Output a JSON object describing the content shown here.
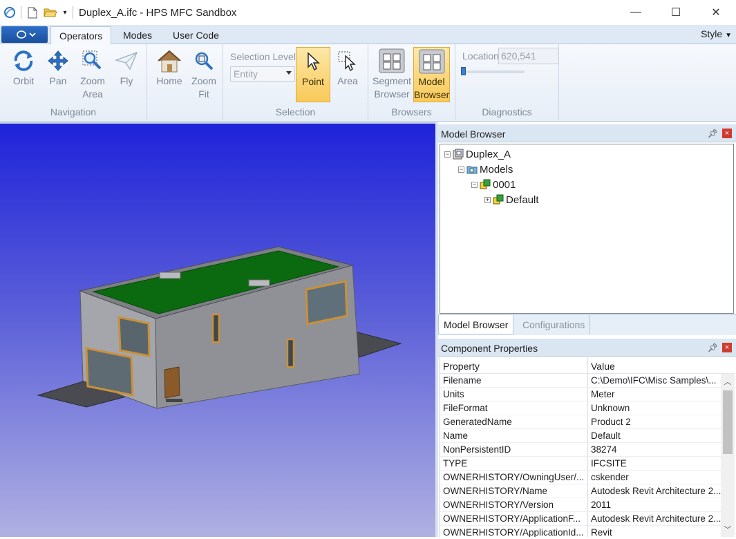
{
  "window": {
    "title": "Duplex_A.ifc - HPS MFC Sandbox",
    "minimize": "—",
    "maximize": "☐",
    "close": "✕"
  },
  "ribbon": {
    "tabs": [
      {
        "label": "Operators",
        "active": true
      },
      {
        "label": "Modes",
        "active": false
      },
      {
        "label": "User Code",
        "active": false
      }
    ],
    "style_label": "Style",
    "groups": {
      "navigation": {
        "label": "Navigation",
        "buttons": [
          {
            "label": "Orbit",
            "icon": "orbit-icon"
          },
          {
            "label": "Pan",
            "icon": "pan-icon"
          },
          {
            "label": "Zoom Area",
            "icon": "zoom-area-icon"
          },
          {
            "label": "Fly",
            "icon": "fly-icon"
          }
        ]
      },
      "home": {
        "buttons": [
          {
            "label": "Home",
            "icon": "home-icon"
          },
          {
            "label": "Zoom Fit",
            "icon": "zoom-fit-icon"
          }
        ]
      },
      "selection": {
        "label": "Selection",
        "level_label": "Selection Level",
        "level_value": "Entity",
        "buttons": [
          {
            "label": "Point",
            "icon": "point-cursor-icon",
            "active": true
          },
          {
            "label": "Area",
            "icon": "area-select-icon",
            "active": false
          }
        ]
      },
      "browsers": {
        "label": "Browsers",
        "buttons": [
          {
            "label": "Segment Browser",
            "icon": "segment-browser-icon",
            "active": false
          },
          {
            "label": "Model Browser",
            "icon": "model-browser-icon",
            "active": true
          }
        ]
      },
      "diagnostics": {
        "label": "Diagnostics",
        "location_label": "Location",
        "location_value": "620,541"
      }
    }
  },
  "model_browser": {
    "title": "Model Browser",
    "tree": [
      {
        "label": "Duplex_A",
        "expander": "−"
      },
      {
        "label": "Models",
        "expander": "−"
      },
      {
        "label": "0001",
        "expander": "−"
      },
      {
        "label": "Default",
        "expander": "+"
      }
    ],
    "tabs": [
      {
        "label": "Model Browser",
        "active": true
      },
      {
        "label": "Configurations",
        "active": false
      }
    ]
  },
  "component_properties": {
    "title": "Component Properties",
    "columns": [
      "Property",
      "Value"
    ],
    "rows": [
      [
        "Filename",
        "C:\\Demo\\IFC\\Misc Samples\\..."
      ],
      [
        "Units",
        "Meter"
      ],
      [
        "FileFormat",
        "Unknown"
      ],
      [
        "GeneratedName",
        "Product 2"
      ],
      [
        "Name",
        "Default"
      ],
      [
        "NonPersistentID",
        "38274"
      ],
      [
        "TYPE",
        "IFCSITE"
      ],
      [
        "OWNERHISTORY/OwningUser/...",
        "cskender"
      ],
      [
        "OWNERHISTORY/Name",
        "Autodesk Revit Architecture 2..."
      ],
      [
        "OWNERHISTORY/Version",
        "2011"
      ],
      [
        "OWNERHISTORY/ApplicationF...",
        "Autodesk Revit Architecture 2..."
      ],
      [
        "OWNERHISTORY/ApplicationId...",
        "Revit"
      ]
    ]
  },
  "colors": {
    "ribbon_active": "#f9c95a",
    "viewport_top": "#1f23d9",
    "roof": "#0b6a10",
    "wall": "#8a8c92"
  }
}
